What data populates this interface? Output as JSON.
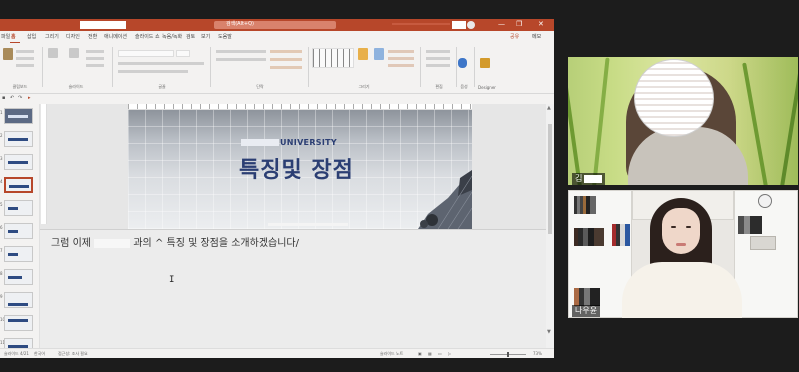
{
  "ppt": {
    "search_placeholder": "검색(Alt+Q)",
    "window_controls": {
      "minimize": "—",
      "restore": "❐",
      "close": "✕"
    },
    "tabs": [
      "파일",
      "홈",
      "삽입",
      "그리기",
      "디자인",
      "전환",
      "애니메이션",
      "슬라이드 쇼",
      "녹음/녹화",
      "검토",
      "보기",
      "도움말"
    ],
    "share_label": "공유",
    "comments_label": "메모",
    "ribbon_groups": [
      "클립보드",
      "슬라이드",
      "글꼴",
      "단락",
      "그리기",
      "편집",
      "음성",
      "Designer"
    ],
    "ribbon_labels": {
      "new_slide": "새 슬라이드",
      "reuse_slide": "슬라이드 다시 사용",
      "dictate": "받아쓰기",
      "designer": "디자인 아이디어",
      "find": "찾기",
      "replace": "바꾸기",
      "select": "선택"
    },
    "slide_numbers": [
      "1",
      "2",
      "3",
      "4",
      "5",
      "6",
      "7",
      "8",
      "9",
      "10",
      "11",
      "12",
      "13"
    ],
    "slide": {
      "university_label": "UNIVERSITY",
      "title": "특징및 장점"
    },
    "notes": {
      "prefix": "그럼 이제",
      "suffix": "과의 ^ 특징 및 장점을 소개하겠습니다/"
    },
    "status": {
      "slide_count": "슬라이드 4/21",
      "language": "한국어",
      "accessibility": "접근성: 조사 필요",
      "notes_button": "슬라이드 노트",
      "zoom": "73%"
    }
  },
  "participants": [
    {
      "name": "김"
    },
    {
      "name": "나우윤"
    }
  ],
  "colors": {
    "ppt_accent": "#b7472a",
    "slide_title": "#2b3e73"
  }
}
